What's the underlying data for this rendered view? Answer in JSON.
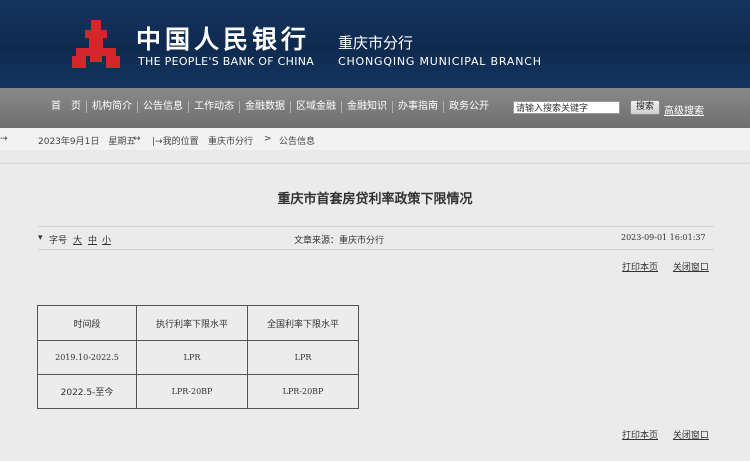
{
  "header": {
    "cn_name": "中国人民银行",
    "cn_branch": "重庆市分行",
    "en_name": "THE PEOPLE'S BANK OF CHINA",
    "en_branch": "CHONGQING MUNICIPAL BRANCH",
    "logo_icon": "pboc-logo-icon",
    "logo_color": "#d6262c"
  },
  "nav": {
    "items": [
      "首　页",
      "机构简介",
      "公告信息",
      "工作动态",
      "金融数据",
      "区域金融",
      "金融知识",
      "办事指南",
      "政务公开"
    ],
    "search_placeholder": "请输入搜索关键字",
    "search_button": "搜索",
    "advanced_search": "高级搜索"
  },
  "breadcrumb": {
    "date": "2023年9月1日　星期五",
    "prefix": "|→我的位置",
    "home": "重庆市分行",
    "sep": ">",
    "current": "公告信息"
  },
  "article": {
    "title": "重庆市首套房贷利率政策下限情况",
    "font_label": "字号",
    "font_large": "大",
    "font_medium": "中",
    "font_small": "小",
    "source": "文章来源：重庆市分行",
    "timestamp": "2023-09-01 16:01:37",
    "print": "打印本页",
    "close": "关闭窗口"
  },
  "table": {
    "headers": [
      "时间段",
      "执行利率下限水平",
      "全国利率下限水平"
    ],
    "rows": [
      [
        "2019.10-2022.5",
        "LPR",
        "LPR"
      ],
      [
        "2022.5-至今",
        "LPR-20BP",
        "LPR-20BP"
      ]
    ]
  }
}
